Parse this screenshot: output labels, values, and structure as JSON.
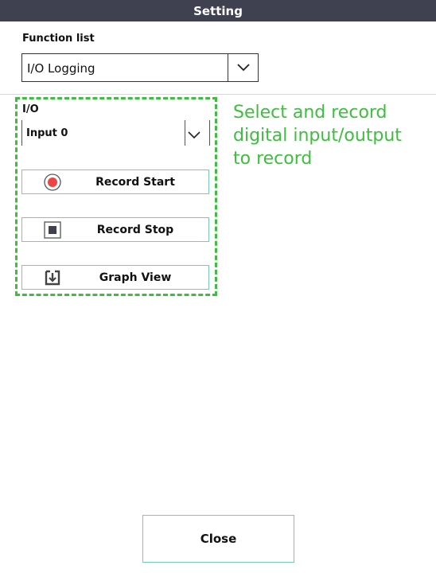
{
  "window": {
    "title": "Setting"
  },
  "function_list": {
    "label": "Function list",
    "selected": "I/O Logging"
  },
  "io": {
    "label": "I/O",
    "selected": "Input 0"
  },
  "buttons": {
    "record_start": "Record Start",
    "record_stop": "Record Stop",
    "graph_view": "Graph View"
  },
  "annotation": {
    "line1": "Select and record",
    "line2": "digital input/output",
    "line3": "to record"
  },
  "footer": {
    "close_label": "Close"
  },
  "colors": {
    "titlebar": "#3f4151",
    "accent_green": "#3cbf3c",
    "button_border": "#6fcfae",
    "record_red": "#ee4444",
    "stop_dark": "#3f4151"
  },
  "icons": {
    "record_start": "record-circle-icon",
    "record_stop": "stop-square-icon",
    "graph_view": "graph-view-icon"
  }
}
